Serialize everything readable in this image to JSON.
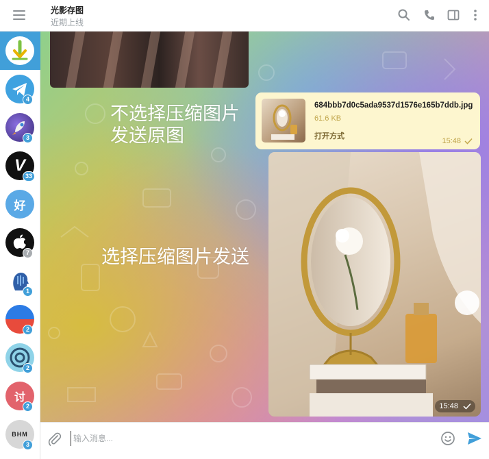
{
  "header": {
    "title": "光影存图",
    "status": "近期上线"
  },
  "sidebar": {
    "items": [
      {
        "name": "chat-1",
        "badge": "",
        "color": "#ffffff",
        "active": true
      },
      {
        "name": "chat-2",
        "badge": "4",
        "color": "#3fa2e0"
      },
      {
        "name": "chat-3",
        "badge": "3",
        "color": "#5e4aa8"
      },
      {
        "name": "chat-4",
        "badge": "33",
        "color": "#111111",
        "letter": "V"
      },
      {
        "name": "chat-5",
        "badge": "",
        "color": "#5aa9e6",
        "letter": "好"
      },
      {
        "name": "chat-6",
        "badge": "7",
        "color": "#111111"
      },
      {
        "name": "chat-7",
        "badge": "1",
        "color": "#ffffff"
      },
      {
        "name": "chat-8",
        "badge": "2",
        "color": "#e84b3c"
      },
      {
        "name": "chat-9",
        "badge": "2",
        "color": "#8fd3e8"
      },
      {
        "name": "chat-10",
        "badge": "2",
        "color": "#e2636c",
        "letter": "讨"
      },
      {
        "name": "chat-11",
        "badge": "3",
        "color": "#d7d7d7",
        "letter": "BHM"
      }
    ]
  },
  "chat": {
    "overlay_1_line1": "不选择压缩图片",
    "overlay_1_line2": "发送原图",
    "overlay_2": "选择压缩图片发送",
    "file": {
      "name": "684bbb7d0c5ada9537d1576e165b7ddb.jpg",
      "size": "61.6 KB",
      "action": "打开方式",
      "time": "15:48"
    },
    "photo_time": "15:48"
  },
  "composer": {
    "placeholder": "输入消息..."
  }
}
